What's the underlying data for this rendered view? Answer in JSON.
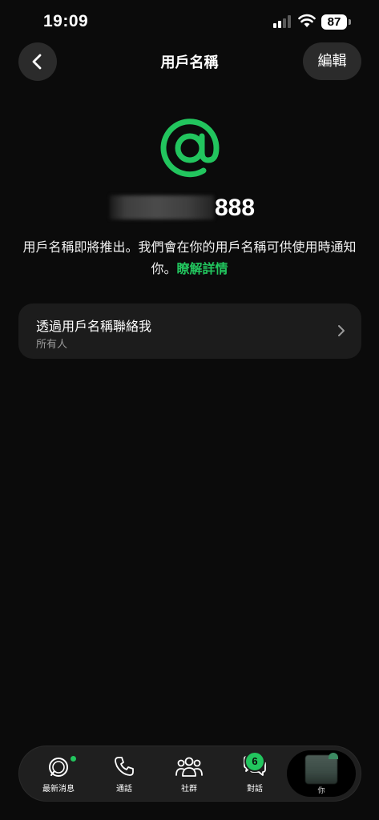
{
  "status_bar": {
    "time": "19:09",
    "battery": "87"
  },
  "nav": {
    "title": "用戶名稱",
    "edit_label": "編輯"
  },
  "profile": {
    "username_visible_suffix": "888"
  },
  "description": {
    "text": "用戶名稱即將推出。我們會在你的用戶名稱可供使用時通知你。",
    "link_text": "瞭解詳情"
  },
  "setting": {
    "title": "透過用戶名稱聯絡我",
    "value": "所有人"
  },
  "tabs": {
    "news_label": "最新消息",
    "calls_label": "通話",
    "community_label": "社群",
    "chats_label": "對話",
    "chats_badge": "6",
    "profile_label": "你"
  },
  "colors": {
    "accent": "#22c55e",
    "background": "#0b0b0b",
    "card": "#1c1c1c"
  },
  "icons": {
    "back": "chevron-left-icon",
    "mention": "at-sign-icon",
    "setting_chevron": "chevron-right-icon",
    "news": "news-ring-icon",
    "calls": "phone-icon",
    "community": "people-icon",
    "chats": "chat-bubbles-icon"
  }
}
